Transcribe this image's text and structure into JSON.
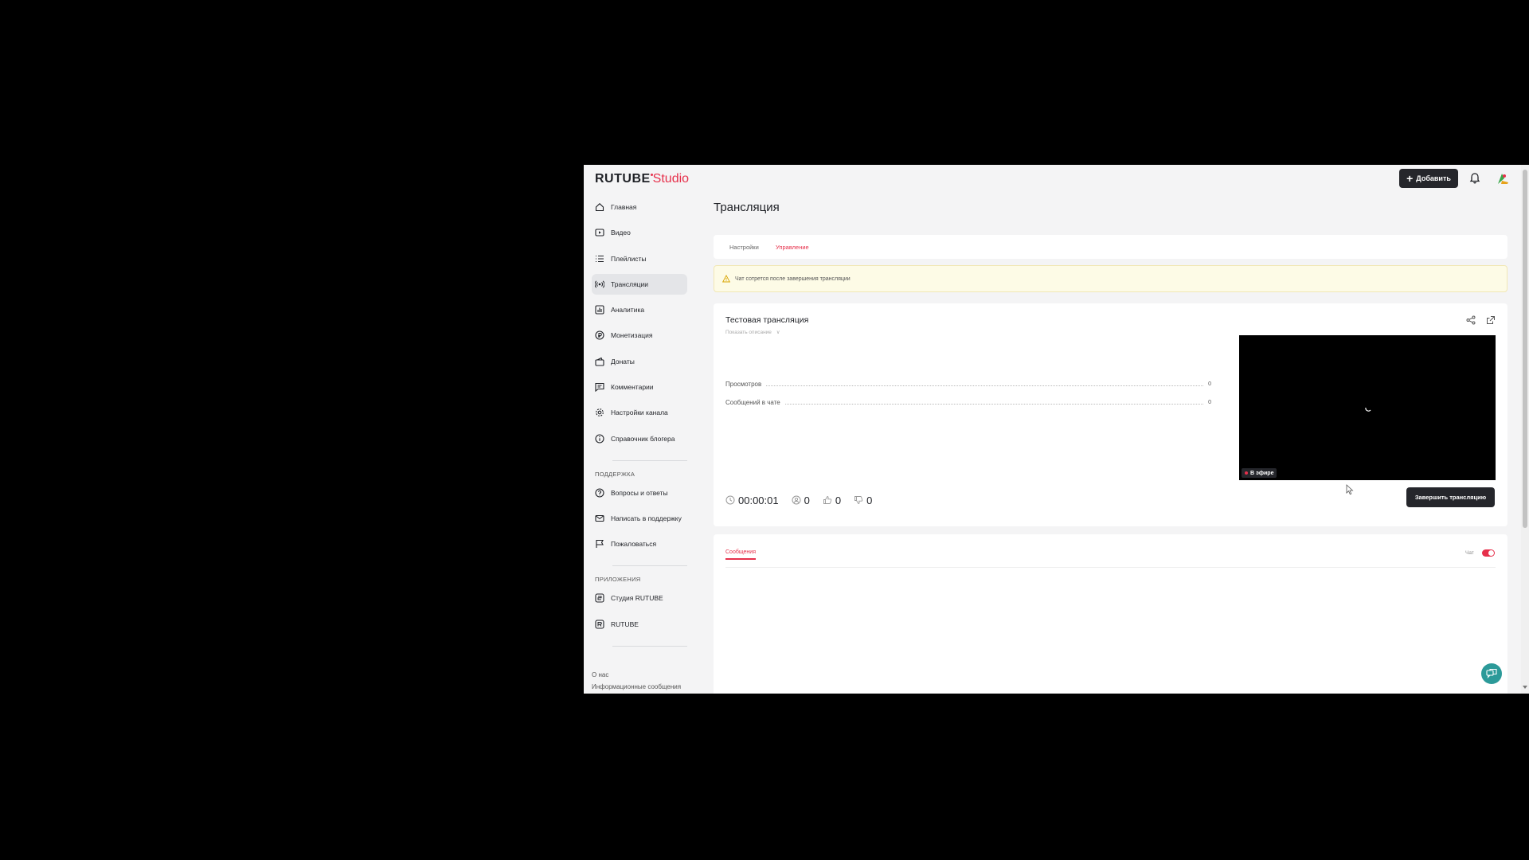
{
  "header": {
    "logo_main": "RUTUBE",
    "logo_sub": "Studio",
    "add_button": "Добавить",
    "plus_glyph": "+"
  },
  "sidebar": {
    "items": [
      {
        "label": "Главная",
        "icon": "home-icon",
        "active": false
      },
      {
        "label": "Видео",
        "icon": "video-icon",
        "active": false
      },
      {
        "label": "Плейлисты",
        "icon": "playlist-icon",
        "active": false
      },
      {
        "label": "Трансляции",
        "icon": "broadcast-icon",
        "active": true
      },
      {
        "label": "Аналитика",
        "icon": "analytics-icon",
        "active": false
      },
      {
        "label": "Монетизация",
        "icon": "monetization-icon",
        "active": false
      },
      {
        "label": "Донаты",
        "icon": "donate-icon",
        "active": false
      },
      {
        "label": "Комментарии",
        "icon": "comments-icon",
        "active": false
      },
      {
        "label": "Настройки канала",
        "icon": "gear-icon",
        "active": false
      },
      {
        "label": "Справочник блогера",
        "icon": "info-icon",
        "active": false
      }
    ],
    "support_title": "ПОДДЕРЖКА",
    "support_items": [
      {
        "label": "Вопросы и ответы",
        "icon": "question-icon"
      },
      {
        "label": "Написать в поддержку",
        "icon": "mail-icon"
      },
      {
        "label": "Пожаловаться",
        "icon": "flag-icon"
      }
    ],
    "apps_title": "ПРИЛОЖЕНИЯ",
    "apps_items": [
      {
        "label": "Студия RUTUBE",
        "icon": "studio-app-icon"
      },
      {
        "label": "RUTUBE",
        "icon": "rutube-app-icon"
      }
    ],
    "footer_links": [
      "О нас",
      "Информационные сообщения"
    ]
  },
  "main": {
    "title": "Трансляция",
    "tabs": [
      {
        "label": "Настройки",
        "active": false
      },
      {
        "label": "Управление",
        "active": true
      }
    ],
    "alert_text": "Чат сотрется после завершения трансляции",
    "stream": {
      "title": "Тестовая трансляция",
      "show_description": "Показать описание",
      "chevron": "∨",
      "stats": [
        {
          "label": "Просмотров",
          "value": "0"
        },
        {
          "label": "Сообщений в чате",
          "value": "0"
        }
      ],
      "live_badge": "В эфире",
      "duration": "00:00:01",
      "viewers": "0",
      "likes": "0",
      "dislikes": "0",
      "end_button": "Завершить трансляцию"
    },
    "chat": {
      "tab_label": "Сообщения",
      "toggle_label": "Чат",
      "toggle_on": true
    }
  },
  "colors": {
    "accent": "#e6304b",
    "dark_button": "#25262b",
    "fab": "#2c9a99",
    "alert_bg": "#fdfbe6"
  }
}
